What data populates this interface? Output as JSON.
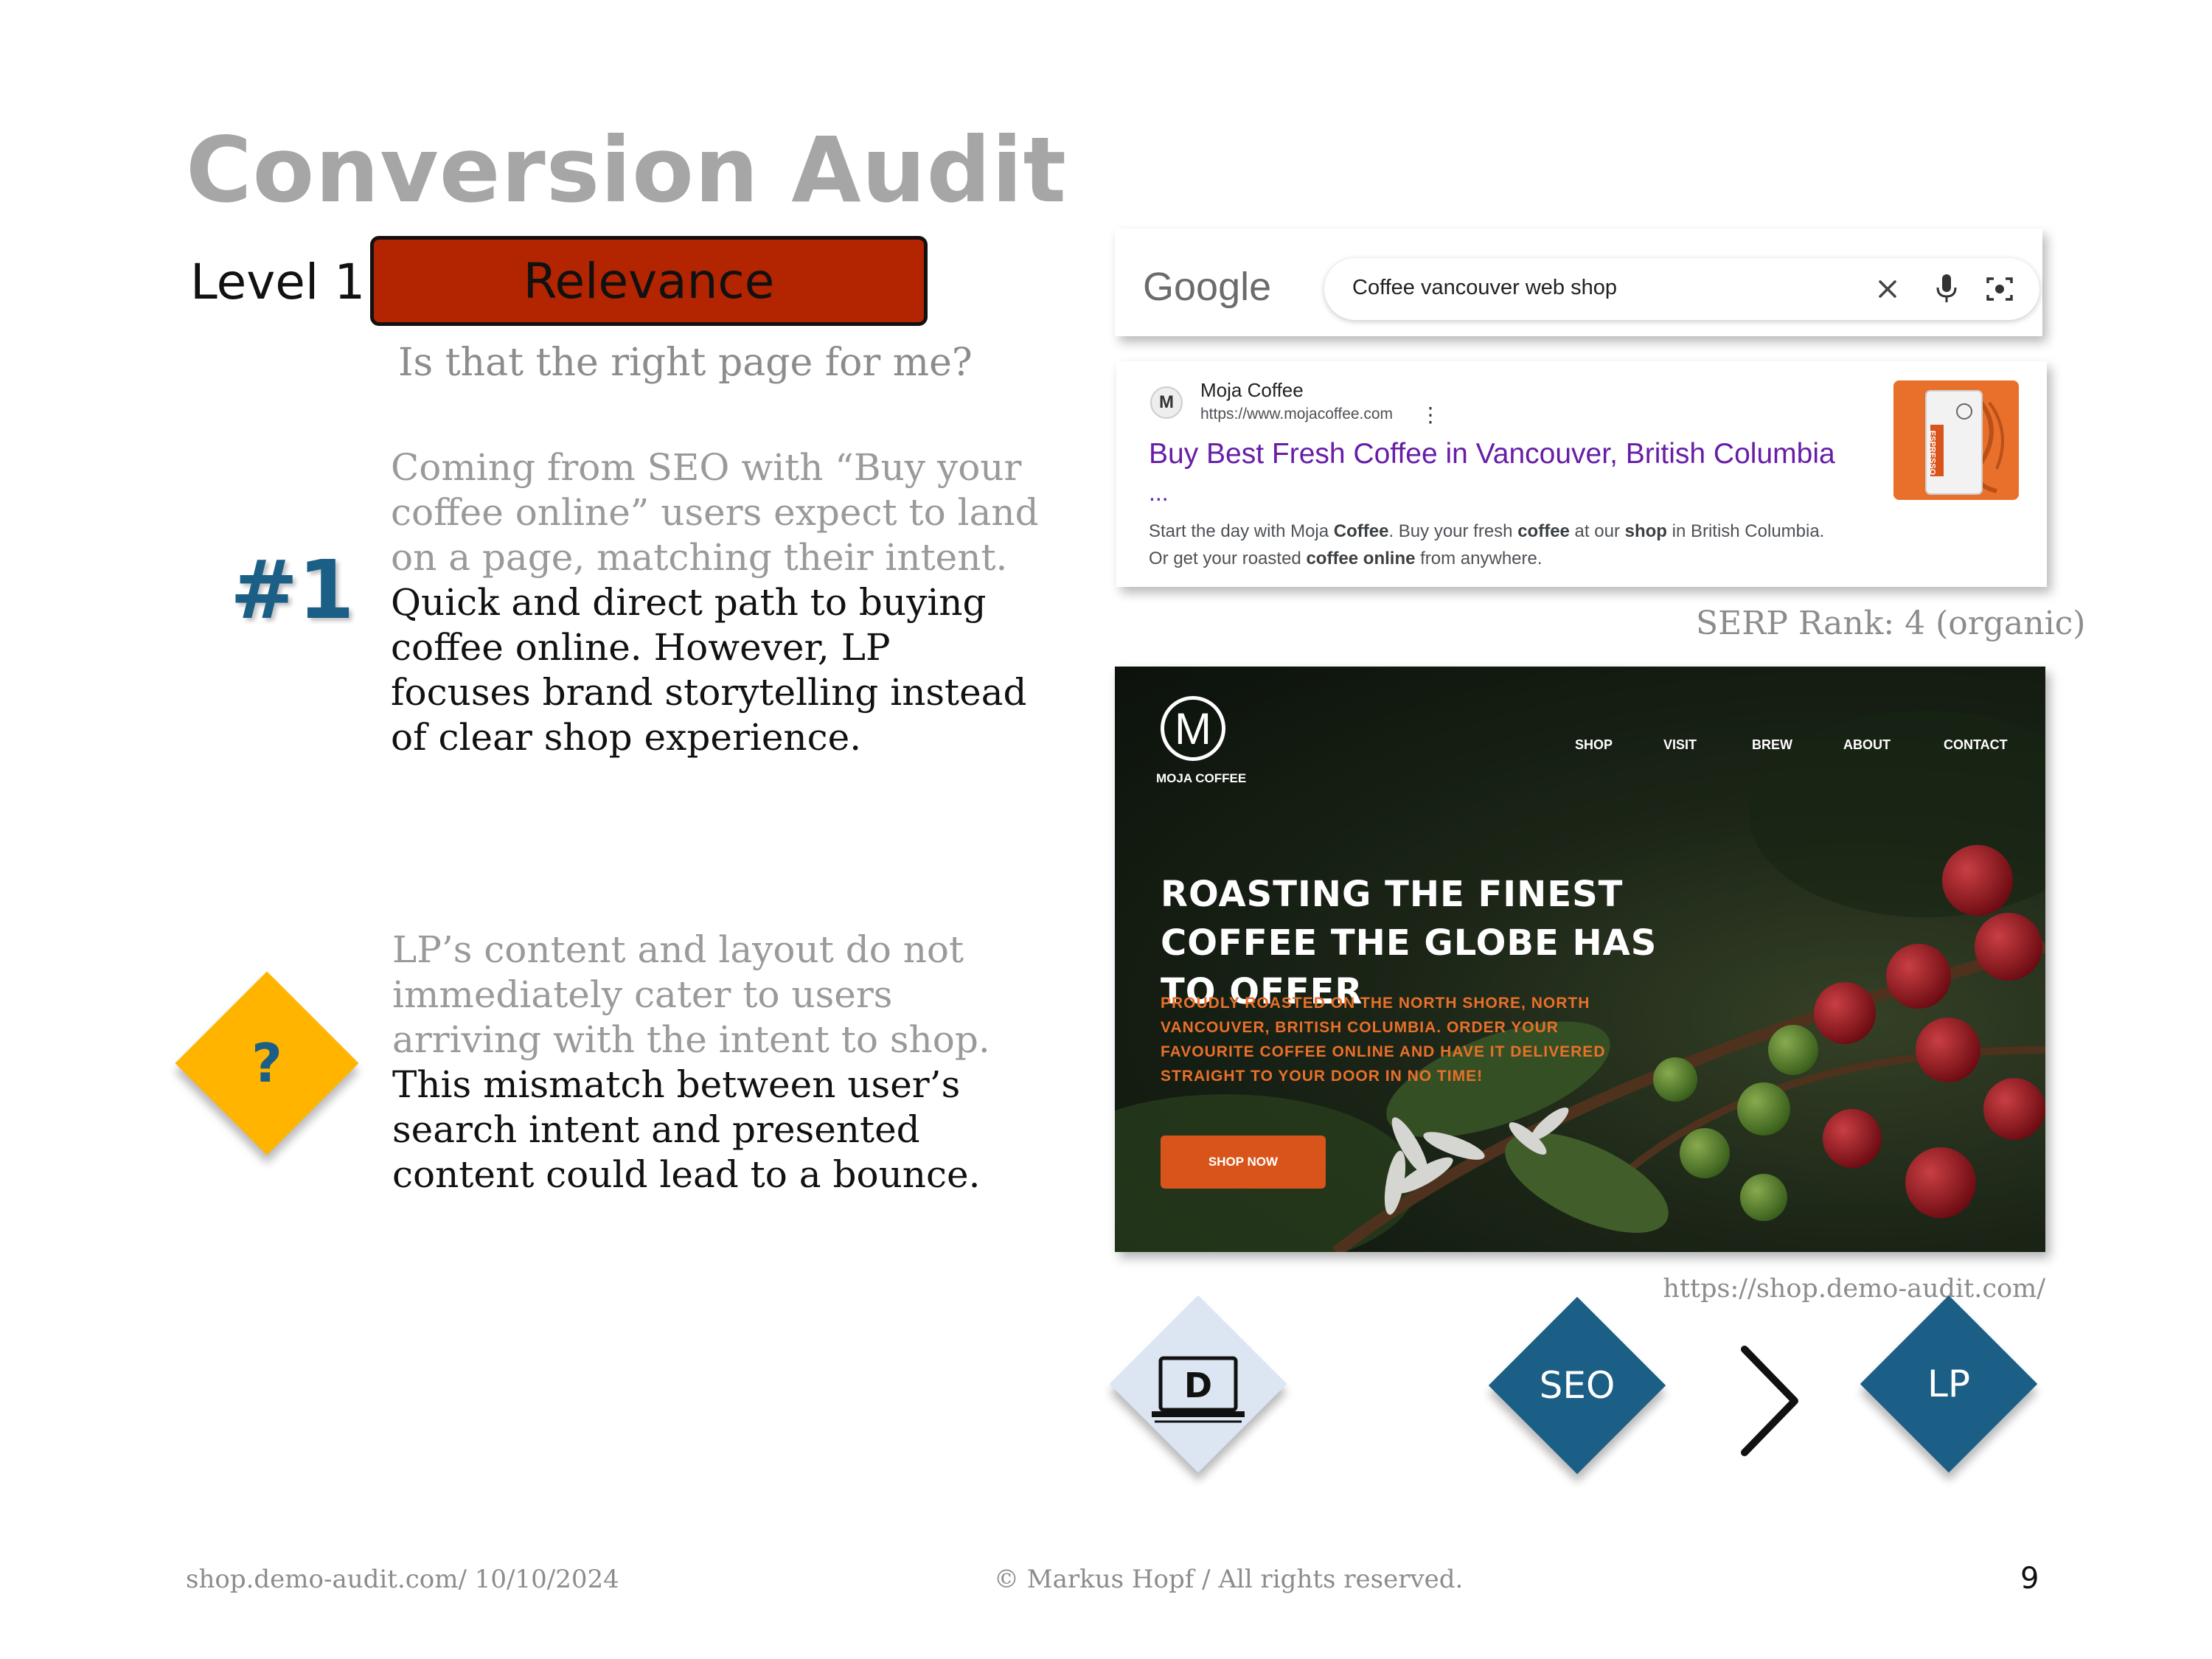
{
  "slide": {
    "title": "Conversion Audit",
    "level_label": "Level 1",
    "level_name": "Relevance",
    "question": "Is that the right page for me?",
    "finding_number": "#1",
    "finding_muted": "Coming from SEO with “Buy your coffee online” users expect to land on a page, matching their intent.",
    "finding_dark": "Quick and direct path to buying coffee online. However, LP focuses brand storytelling instead of clear shop experience.",
    "impact_symbol": "?",
    "impact_muted": "LP’s content and layout do not immediately cater to users arriving with the intent to shop.",
    "impact_dark": "This mismatch between user’s search intent and presented content could lead to a bounce.",
    "serp_rank": "SERP Rank: 4 (organic)",
    "lp_url": "https://shop.demo-audit.com/",
    "device_letter": "D",
    "flow_from": "SEO",
    "flow_to": "LP",
    "footer_left": "shop.demo-audit.com/ 10/10/2024",
    "footer_center": "© Markus Hopf / All rights reserved.",
    "page_number": "9"
  },
  "colors": {
    "relevance_red": "#b32400",
    "accent_blue": "#1b5e86",
    "warning_yellow": "#ffb400",
    "device_bg": "#dbe6f2",
    "muted_text": "#9a9a9a"
  },
  "google": {
    "logo": "Google",
    "query": "Coffee vancouver web shop",
    "result": {
      "favicon_letter": "M",
      "site_name": "Moja Coffee",
      "site_url": "https://www.mojacoffee.com",
      "title": "Buy Best Fresh Coffee in Vancouver, British Columbia",
      "ellipsis": "...",
      "snippet_line1_a": "Start the day with Moja ",
      "snippet_line1_b": "Coffee",
      "snippet_line1_c": ". Buy your fresh ",
      "snippet_line1_d": "coffee",
      "snippet_line1_e": " at our ",
      "snippet_line1_f": "shop",
      "snippet_line1_g": " in British Columbia.",
      "snippet_line2_a": "Or get your roasted ",
      "snippet_line2_b": "coffee online",
      "snippet_line2_c": " from anywhere.",
      "thumb_label": "ESPRESSO"
    }
  },
  "landing": {
    "logo_letter": "M",
    "brand": "MOJA COFFEE",
    "nav": [
      "SHOP",
      "VISIT",
      "BREW",
      "ABOUT",
      "CONTACT"
    ],
    "headline": "ROASTING THE FINEST COFFEE THE GLOBE HAS TO OFFER",
    "subline": "PROUDLY ROASTED ON THE NORTH SHORE, NORTH VANCOUVER, BRITISH COLUMBIA. ORDER YOUR FAVOURITE COFFEE ONLINE AND HAVE IT DELIVERED STRAIGHT TO YOUR DOOR IN NO TIME!",
    "cta": "SHOP NOW"
  }
}
